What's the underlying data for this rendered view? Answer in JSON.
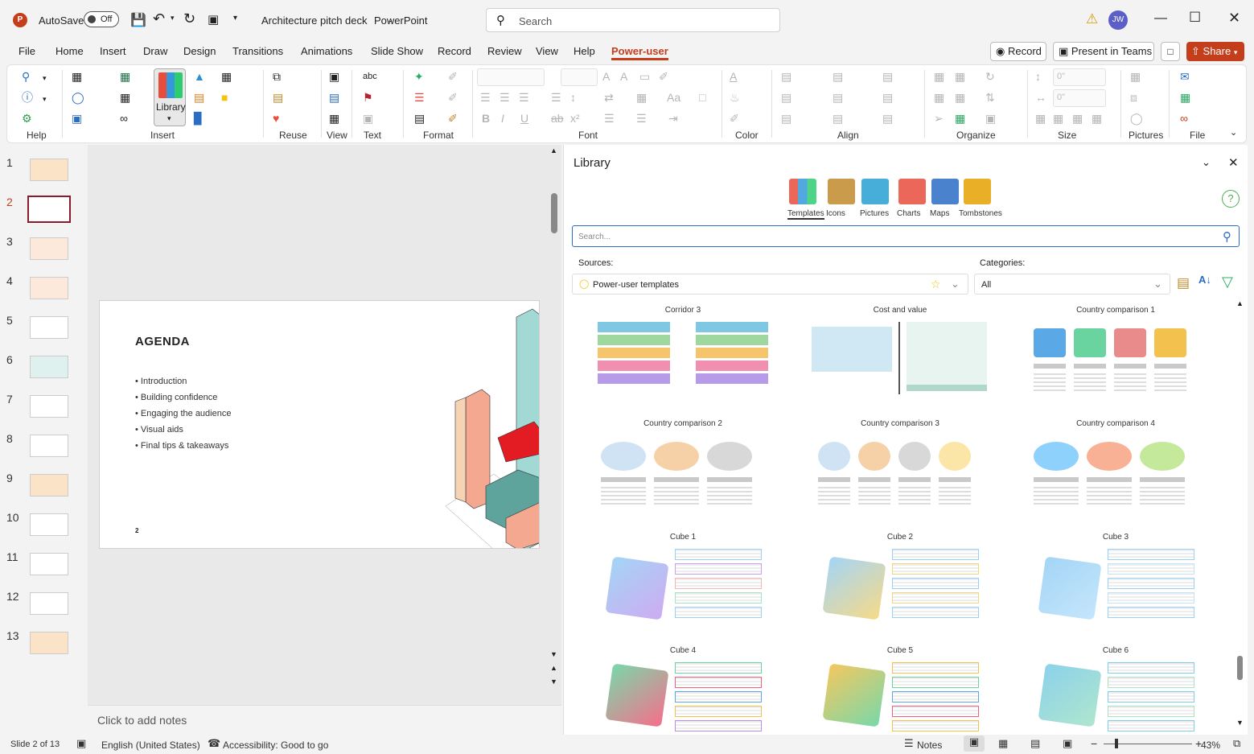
{
  "titlebar": {
    "autosave_label": "AutoSave",
    "autosave_state": "Off",
    "doc_title": "Architecture pitch deck",
    "app_name": "PowerPoint",
    "search_placeholder": "Search",
    "avatar_initials": "JW"
  },
  "tabs": [
    "File",
    "Home",
    "Insert",
    "Draw",
    "Design",
    "Transitions",
    "Animations",
    "Slide Show",
    "Record",
    "Review",
    "View",
    "Help",
    "Power-user"
  ],
  "tab_actions": {
    "record": "Record",
    "present": "Present in Teams",
    "share": "Share"
  },
  "ribbon": {
    "library_label": "Library",
    "groups": [
      "Help",
      "Insert",
      "Reuse",
      "View",
      "Text",
      "Format",
      "Font",
      "Color",
      "Align",
      "Organize",
      "Size",
      "Pictures",
      "File"
    ],
    "size_w": "0\"",
    "size_h": "0\""
  },
  "thumbs": [
    "1",
    "2",
    "3",
    "4",
    "5",
    "6",
    "7",
    "8",
    "9",
    "10",
    "11",
    "12",
    "13"
  ],
  "slide": {
    "title": "AGENDA",
    "bullets": [
      "Introduction",
      "Building confidence",
      "Engaging the audience",
      "Visual aids",
      "Final tips & takeaways"
    ],
    "number": "2"
  },
  "notes_placeholder": "Click to add notes",
  "library": {
    "title": "Library",
    "tabs": [
      "Templates",
      "Icons",
      "Pictures",
      "Charts",
      "Maps",
      "Tombstones"
    ],
    "search_placeholder": "Search...",
    "sources_label": "Sources:",
    "sources_value": "Power-user templates",
    "categories_label": "Categories:",
    "categories_value": "All",
    "templates": [
      "Corridor 3",
      "Cost and value",
      "Country comparison 1",
      "Country comparison 2",
      "Country comparison 3",
      "Country comparison 4",
      "Cube 1",
      "Cube 2",
      "Cube 3",
      "Cube 4",
      "Cube 5",
      "Cube 6"
    ]
  },
  "status": {
    "slide_of": "Slide 2 of 13",
    "language": "English (United States)",
    "accessibility": "Accessibility: Good to go",
    "notes": "Notes",
    "zoom": "43%"
  },
  "colors": {
    "accent": "#c43e1c",
    "share": "#c43e1c"
  }
}
